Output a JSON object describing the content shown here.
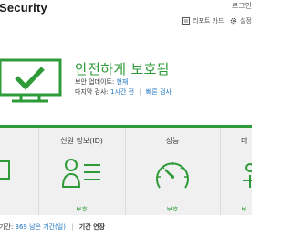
{
  "header": {
    "app_title": "Security",
    "login_label": "로그인",
    "toolbar": [
      {
        "label": "리포트 카드",
        "icon": "report-card-icon"
      },
      {
        "label": "설정",
        "icon": "gear-icon"
      }
    ]
  },
  "status": {
    "title": "안전하게 보호됨",
    "update_label": "보안 업데이트:",
    "update_value": "현재",
    "last_scan_label": "마지막 검사:",
    "last_scan_value": "1시간 전",
    "quick_scan_link": "빠른 검사",
    "accent_color": "#2e9b38",
    "link_color": "#1e73be"
  },
  "tiles": [
    {
      "title": "",
      "status": "",
      "icon": "monitor-icon"
    },
    {
      "title": "신원 정보(ID)",
      "status": "보호",
      "icon": "identity-icon"
    },
    {
      "title": "성능",
      "status": "보호",
      "icon": "speedometer-icon"
    },
    {
      "title": "더",
      "status": "보",
      "icon": "more-icon"
    }
  ],
  "footer": {
    "remaining_prefix": "기간:",
    "remaining_days": "369 남은 기간(일)",
    "extend_label": "기간 연장"
  }
}
